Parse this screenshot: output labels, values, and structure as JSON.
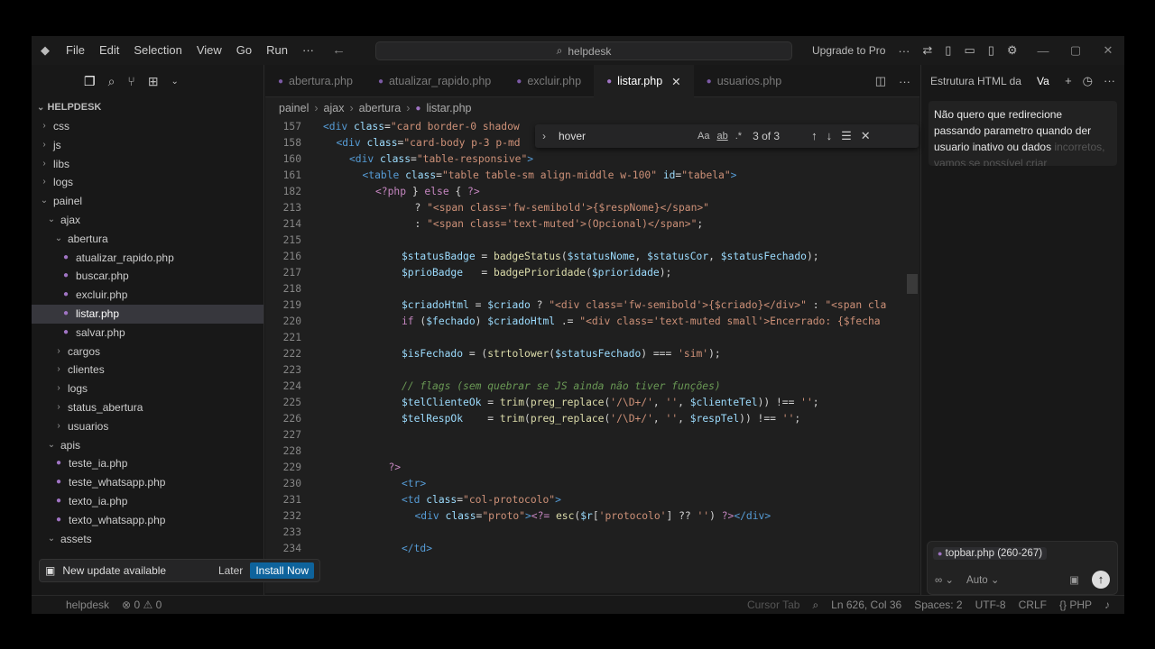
{
  "titlebar": {
    "menu": [
      "File",
      "Edit",
      "Selection",
      "View",
      "Go",
      "Run",
      "···"
    ],
    "search_text": "helpdesk",
    "upgrade_label": "Upgrade to Pro"
  },
  "sidebar": {
    "explorer_title": "HELPDESK",
    "tree": [
      {
        "label": "css",
        "kind": "folder",
        "depth": 0,
        "open": false
      },
      {
        "label": "js",
        "kind": "folder",
        "depth": 0,
        "open": false
      },
      {
        "label": "libs",
        "kind": "folder",
        "depth": 0,
        "open": false
      },
      {
        "label": "logs",
        "kind": "folder",
        "depth": 0,
        "open": false
      },
      {
        "label": "painel",
        "kind": "folder",
        "depth": 0,
        "open": true
      },
      {
        "label": "ajax",
        "kind": "folder",
        "depth": 1,
        "open": true
      },
      {
        "label": "abertura",
        "kind": "folder",
        "depth": 2,
        "open": true
      },
      {
        "label": "atualizar_rapido.php",
        "kind": "php",
        "depth": 3
      },
      {
        "label": "buscar.php",
        "kind": "php",
        "depth": 3
      },
      {
        "label": "excluir.php",
        "kind": "php",
        "depth": 3
      },
      {
        "label": "listar.php",
        "kind": "php",
        "depth": 3,
        "selected": true
      },
      {
        "label": "salvar.php",
        "kind": "php",
        "depth": 3
      },
      {
        "label": "cargos",
        "kind": "folder",
        "depth": 2,
        "open": false
      },
      {
        "label": "clientes",
        "kind": "folder",
        "depth": 2,
        "open": false
      },
      {
        "label": "logs",
        "kind": "folder",
        "depth": 2,
        "open": false
      },
      {
        "label": "status_abertura",
        "kind": "folder",
        "depth": 2,
        "open": false
      },
      {
        "label": "usuarios",
        "kind": "folder",
        "depth": 2,
        "open": false
      },
      {
        "label": "apis",
        "kind": "folder",
        "depth": 1,
        "open": true
      },
      {
        "label": "teste_ia.php",
        "kind": "php",
        "depth": 2
      },
      {
        "label": "teste_whatsapp.php",
        "kind": "php",
        "depth": 2
      },
      {
        "label": "texto_ia.php",
        "kind": "php",
        "depth": 2
      },
      {
        "label": "texto_whatsapp.php",
        "kind": "php",
        "depth": 2
      },
      {
        "label": "assets",
        "kind": "folder",
        "depth": 1,
        "open": true
      }
    ]
  },
  "update_toast": {
    "message": "New update available",
    "later_label": "Later",
    "install_label": "Install Now"
  },
  "tabs": [
    {
      "label": "abertura.php",
      "active": false
    },
    {
      "label": "atualizar_rapido.php",
      "active": false
    },
    {
      "label": "excluir.php",
      "active": false
    },
    {
      "label": "listar.php",
      "active": true
    },
    {
      "label": "usuarios.php",
      "active": false
    }
  ],
  "breadcrumb": [
    "painel",
    "ajax",
    "abertura",
    "listar.php"
  ],
  "find": {
    "query": "hover",
    "options": [
      "Aa",
      "ab",
      ".*"
    ],
    "count": "3 of 3"
  },
  "editor_lines": [
    {
      "n": "157",
      "indent": 0,
      "html": "<span class='k-tag'>&lt;div</span> <span class='k-attr'>class</span>=<span class='k-str'>\"card border-0 shadow</span>"
    },
    {
      "n": "158",
      "indent": 1,
      "html": "<span class='k-tag'>&lt;div</span> <span class='k-attr'>class</span>=<span class='k-str'>\"card-body p-3 p-md</span>"
    },
    {
      "n": "160",
      "indent": 2,
      "html": "<span class='k-tag'>&lt;div</span> <span class='k-attr'>class</span>=<span class='k-str'>\"table-responsive\"</span><span class='k-tag'>&gt;</span>"
    },
    {
      "n": "161",
      "indent": 3,
      "html": "<span class='k-tag'>&lt;table</span> <span class='k-attr'>class</span>=<span class='k-str'>\"table table-sm align-middle w-100\"</span> <span class='k-attr'>id</span>=<span class='k-str'>\"tabela\"</span><span class='k-tag'>&gt;</span>"
    },
    {
      "n": "182",
      "indent": 4,
      "html": "<span class='k-php'>&lt;?php</span> } <span class='k-php'>else</span> { <span class='k-php'>?&gt;</span>"
    },
    {
      "n": "213",
      "indent": 7,
      "html": "? <span class='k-str'>\"&lt;span class='fw-semibold'&gt;{$respNome}&lt;/span&gt;\"</span>"
    },
    {
      "n": "214",
      "indent": 7,
      "html": ": <span class='k-str'>\"&lt;span class='text-muted'&gt;(Opcional)&lt;/span&gt;\"</span>;"
    },
    {
      "n": "215",
      "indent": 0,
      "html": ""
    },
    {
      "n": "216",
      "indent": 6,
      "html": "<span class='k-attr'>$statusBadge</span> = <span class='k-fn'>badgeStatus</span>(<span class='k-attr'>$statusNome</span>, <span class='k-attr'>$statusCor</span>, <span class='k-attr'>$statusFechado</span>);"
    },
    {
      "n": "217",
      "indent": 6,
      "html": "<span class='k-attr'>$prioBadge</span>   = <span class='k-fn'>badgePrioridade</span>(<span class='k-attr'>$prioridade</span>);"
    },
    {
      "n": "218",
      "indent": 0,
      "html": ""
    },
    {
      "n": "219",
      "indent": 6,
      "html": "<span class='k-attr'>$criadoHtml</span> = <span class='k-attr'>$criado</span> ? <span class='k-str'>\"&lt;div class='fw-semibold'&gt;{$criado}&lt;/div&gt;\"</span> : <span class='k-str'>\"&lt;span cla</span>"
    },
    {
      "n": "220",
      "indent": 6,
      "html": "<span class='k-php'>if</span> (<span class='k-attr'>$fechado</span>) <span class='k-attr'>$criadoHtml</span> .= <span class='k-str'>\"&lt;div class='text-muted small'&gt;Encerrado: {$fecha</span>"
    },
    {
      "n": "221",
      "indent": 0,
      "html": ""
    },
    {
      "n": "222",
      "indent": 6,
      "html": "<span class='k-attr'>$isFechado</span> = (<span class='k-fn'>strtolower</span>(<span class='k-attr'>$statusFechado</span>) === <span class='k-str'>'sim'</span>);"
    },
    {
      "n": "223",
      "indent": 0,
      "html": ""
    },
    {
      "n": "224",
      "indent": 6,
      "html": "<span class='k-cm'>// flags (sem quebrar se JS ainda não tiver funções)</span>"
    },
    {
      "n": "225",
      "indent": 6,
      "html": "<span class='k-attr'>$telClienteOk</span> = <span class='k-fn'>trim</span>(<span class='k-fn'>preg_replace</span>(<span class='k-str'>'/\\D+/'</span>, <span class='k-str'>''</span>, <span class='k-attr'>$clienteTel</span>)) !== <span class='k-str'>''</span>;"
    },
    {
      "n": "226",
      "indent": 6,
      "html": "<span class='k-attr'>$telRespOk</span>    = <span class='k-fn'>trim</span>(<span class='k-fn'>preg_replace</span>(<span class='k-str'>'/\\D+/'</span>, <span class='k-str'>''</span>, <span class='k-attr'>$respTel</span>)) !== <span class='k-str'>''</span>;"
    },
    {
      "n": "227",
      "indent": 0,
      "html": ""
    },
    {
      "n": "228",
      "indent": 0,
      "html": ""
    },
    {
      "n": "229",
      "indent": 5,
      "html": "<span class='k-php'>?&gt;</span>"
    },
    {
      "n": "230",
      "indent": 6,
      "html": "<span class='k-tag'>&lt;tr&gt;</span>"
    },
    {
      "n": "231",
      "indent": 6,
      "html": "<span class='k-tag'>&lt;td</span> <span class='k-attr'>class</span>=<span class='k-str'>\"col-protocolo\"</span><span class='k-tag'>&gt;</span>"
    },
    {
      "n": "232",
      "indent": 7,
      "html": "<span class='k-tag'>&lt;div</span> <span class='k-attr'>class</span>=<span class='k-str'>\"proto\"</span><span class='k-tag'>&gt;</span><span class='k-php'>&lt;?=</span> <span class='k-fn'>esc</span>(<span class='k-attr'>$r</span>[<span class='k-str'>'protocolo'</span>] ?? <span class='k-str'>''</span>) <span class='k-php'>?&gt;</span><span class='k-tag'>&lt;/div&gt;</span>"
    },
    {
      "n": "233",
      "indent": 0,
      "html": ""
    },
    {
      "n": "234",
      "indent": 6,
      "html": "<span class='k-tag'>&lt;/td&gt;</span>"
    }
  ],
  "chat": {
    "header_title": "Estrutura HTML da",
    "header_tab": "Va",
    "message_visible": "Não quero que redirecione passando parametro quando der usuario inativo ou dados",
    "message_faded": "incorretos, vamos se possível criar",
    "context_chip": "topbar.php (260-267)",
    "mode_label": "Auto"
  },
  "statusbar": {
    "workspace": "helpdesk",
    "problems": "0",
    "warnings": "0",
    "cursor_tab": "Cursor Tab",
    "position": "Ln 626, Col 36",
    "spaces": "Spaces: 2",
    "encoding": "UTF-8",
    "eol": "CRLF",
    "language": "PHP"
  }
}
